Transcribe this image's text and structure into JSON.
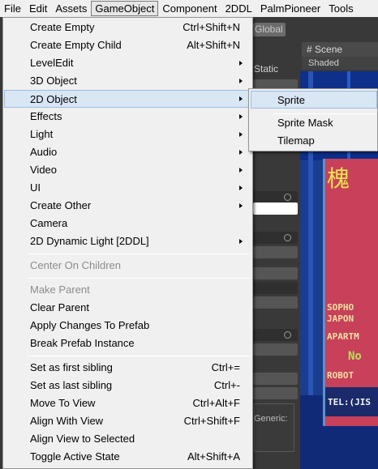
{
  "menubar": {
    "items": [
      "File",
      "Edit",
      "Assets",
      "GameObject",
      "Component",
      "2DDL",
      "PalmPioneer",
      "Tools"
    ]
  },
  "editor": {
    "global_label": "Global",
    "scene_tab_label": "Scene",
    "shaded_label": "Shaded",
    "static_label": "Static",
    "generic_label": "Generic:",
    "sign_text": {
      "glyph": "槐",
      "line1": "SOPHO",
      "line2": "JAPON",
      "line3": "APARTM",
      "line4": "No",
      "line5": "ROBOT",
      "line6": "TEL:(JIS"
    }
  },
  "menu": {
    "create_empty": {
      "label": "Create Empty",
      "shortcut": "Ctrl+Shift+N"
    },
    "create_empty_child": {
      "label": "Create Empty Child",
      "shortcut": "Alt+Shift+N"
    },
    "level_edit": {
      "label": "LevelEdit"
    },
    "object_3d": {
      "label": "3D Object"
    },
    "object_2d": {
      "label": "2D Object"
    },
    "effects": {
      "label": "Effects"
    },
    "light": {
      "label": "Light"
    },
    "audio": {
      "label": "Audio"
    },
    "video": {
      "label": "Video"
    },
    "ui": {
      "label": "UI"
    },
    "create_other": {
      "label": "Create Other"
    },
    "camera": {
      "label": "Camera"
    },
    "dynamic_light": {
      "label": "2D Dynamic Light [2DDL]"
    },
    "center_on_children": {
      "label": "Center On Children"
    },
    "make_parent": {
      "label": "Make Parent"
    },
    "clear_parent": {
      "label": "Clear Parent"
    },
    "apply_changes": {
      "label": "Apply Changes To Prefab"
    },
    "break_prefab": {
      "label": "Break Prefab Instance"
    },
    "set_first_sibling": {
      "label": "Set as first sibling",
      "shortcut": "Ctrl+="
    },
    "set_last_sibling": {
      "label": "Set as last sibling",
      "shortcut": "Ctrl+-"
    },
    "move_to_view": {
      "label": "Move To View",
      "shortcut": "Ctrl+Alt+F"
    },
    "align_with_view": {
      "label": "Align With View",
      "shortcut": "Ctrl+Shift+F"
    },
    "align_view_to_selected": {
      "label": "Align View to Selected"
    },
    "toggle_active": {
      "label": "Toggle Active State",
      "shortcut": "Alt+Shift+A"
    }
  },
  "submenu": {
    "sprite": "Sprite",
    "sprite_mask": "Sprite Mask",
    "tilemap": "Tilemap"
  }
}
